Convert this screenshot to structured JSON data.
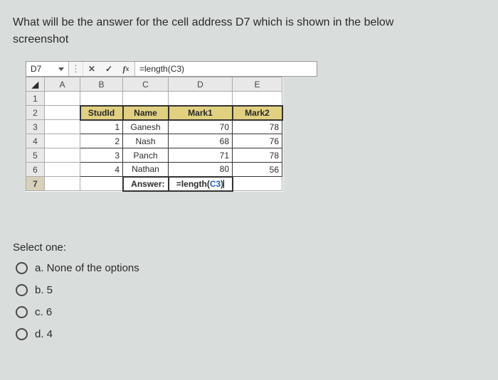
{
  "question": {
    "text_line1": "What will be the answer for the cell address D7 which is shown in the below",
    "text_line2": "screenshot"
  },
  "formula_bar": {
    "cell_ref": "D7",
    "formula": "=length(C3)"
  },
  "columns": [
    "A",
    "B",
    "C",
    "D",
    "E"
  ],
  "rows": [
    "1",
    "2",
    "3",
    "4",
    "5",
    "6",
    "7"
  ],
  "headers": {
    "b": "StudId",
    "c": "Name",
    "d": "Mark1",
    "e": "Mark2"
  },
  "data": [
    {
      "id": "1",
      "name": "Ganesh",
      "m1": "70",
      "m2": "78"
    },
    {
      "id": "2",
      "name": "Nash",
      "m1": "68",
      "m2": "76"
    },
    {
      "id": "3",
      "name": "Panch",
      "m1": "71",
      "m2": "78"
    },
    {
      "id": "4",
      "name": "Nathan",
      "m1": "80",
      "m2": "56"
    }
  ],
  "answer_row": {
    "label": "Answer:",
    "prefix": "=length(",
    "ref": "C3",
    "suffix": ")"
  },
  "select_label": "Select one:",
  "options": {
    "a": "a. None of the options",
    "b": "b. 5",
    "c": "c. 6",
    "d": "d. 4"
  }
}
